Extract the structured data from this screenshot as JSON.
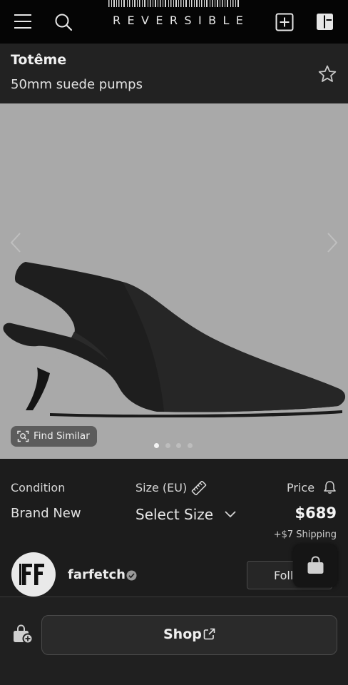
{
  "app": {
    "logo_text": "REVERSIBLE",
    "icons": [
      "menu-icon",
      "search-icon",
      "add-icon",
      "panel-icon"
    ]
  },
  "product": {
    "brand": "Totême",
    "name": "50mm suede pumps",
    "favorite_icon": "star-outline-icon"
  },
  "gallery": {
    "find_similar_label": "Find Similar",
    "image_count": 4,
    "active_index": 0,
    "background_color": "#a9a9a9"
  },
  "details": {
    "condition_label": "Condition",
    "condition_value": "Brand New",
    "size_label": "Size (EU)",
    "size_value": "Select Size",
    "price_label": "Price",
    "price_value": "$689",
    "shipping": "+$7 Shipping"
  },
  "seller": {
    "name": "farfetch",
    "follow_label": "Follow"
  },
  "bottom": {
    "shop_label": "Shop"
  },
  "colors": {
    "background": "#1c1c1c",
    "topbar": "#050505",
    "header": "#222222"
  }
}
